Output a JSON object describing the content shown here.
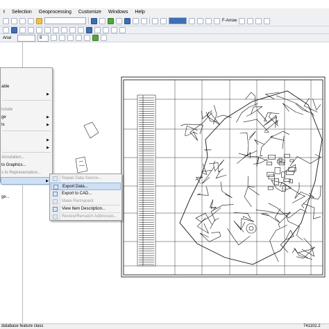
{
  "menubar": {
    "items": [
      "t",
      "Selection",
      "Geoprocessing",
      "Customize",
      "Windows",
      "Help"
    ]
  },
  "toolbar": {
    "font_size": "8",
    "scale_label": "F-Arrow",
    "font_name": "Arial"
  },
  "context_menu": {
    "items": [
      {
        "label": "able",
        "dim": false,
        "arrow": false
      },
      {
        "label": "",
        "dim": false,
        "arrow": true
      },
      {
        "label": "lunate",
        "dim": true,
        "arrow": false
      },
      {
        "label": "ge",
        "dim": false,
        "arrow": true
      },
      {
        "label": "ts",
        "dim": false,
        "arrow": true
      },
      {
        "label": "",
        "dim": false,
        "arrow": true
      },
      {
        "label": "",
        "dim": false,
        "arrow": true
      },
      {
        "label": "Annotation...",
        "dim": true,
        "arrow": false
      },
      {
        "label": "to Graphics...",
        "dim": false,
        "arrow": false
      },
      {
        "label": "s to Representation...",
        "dim": true,
        "arrow": false
      },
      {
        "label": "",
        "dim": false,
        "arrow": true
      },
      {
        "label": "",
        "dim": false,
        "arrow": false
      },
      {
        "label": "ge...",
        "dim": false,
        "arrow": false
      }
    ]
  },
  "submenu": {
    "items": [
      {
        "label": "Repair Data Source...",
        "dim": true
      },
      {
        "label": "Export Data...",
        "dim": false
      },
      {
        "label": "Export to CAD...",
        "dim": false
      },
      {
        "label": "Make Permanent",
        "dim": true
      },
      {
        "label": "View Item Description...",
        "dim": false
      },
      {
        "label": "Review/Rematch Addresses...",
        "dim": true
      }
    ]
  },
  "status": {
    "left": "database feature class",
    "right": "741102.2"
  },
  "colors": {
    "menu_highlight": "#cfe0f4",
    "toolbar_bg": "#eef0f4"
  }
}
